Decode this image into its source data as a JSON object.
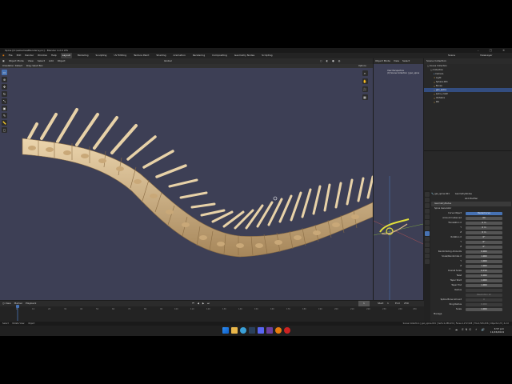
{
  "window": {
    "title": "Spine [D:\\eeGamesBlender\\sync] - Blender 4.2.0 LTS",
    "controls": [
      "–",
      "□",
      "✕"
    ]
  },
  "menubar": {
    "items": [
      "File",
      "Edit",
      "Render",
      "Window",
      "Help"
    ],
    "workspaces": [
      "Layout",
      "Modeling",
      "Sculpting",
      "UV Editing",
      "Texture Paint",
      "Shading",
      "Animation",
      "Rendering",
      "Compositing",
      "Geometry Nodes",
      "Scripting"
    ],
    "active_workspace": "Layout",
    "scene": "Scene",
    "view_layer": "ViewLayer"
  },
  "viewport": {
    "mode": "Object Mode",
    "menus": [
      "View",
      "Select",
      "Add",
      "Object"
    ],
    "orientation": "Global",
    "sub_items": [
      "Orientation:",
      "Default",
      "Drag:",
      "Select Box"
    ],
    "options": "Options"
  },
  "viewport2": {
    "mode": "Object Mode",
    "menus": [
      "View",
      "Select"
    ],
    "info_lines": [
      "User Perspective",
      "(0) Scene Collection | geo_spine"
    ]
  },
  "outliner": {
    "header": "Scene Collection",
    "rows": [
      {
        "label": "Scene Collection",
        "selected": false
      },
      {
        "label": "Collection",
        "selected": false
      },
      {
        "label": "Camera",
        "selected": false
      },
      {
        "label": "Light",
        "selected": false
      },
      {
        "label": "Sphere.001",
        "selected": false
      },
      {
        "label": "Bones",
        "selected": false
      },
      {
        "label": "geo_spine",
        "selected": true
      },
      {
        "label": "spine_mesh",
        "selected": false
      },
      {
        "label": "Vertebra",
        "selected": false
      },
      {
        "label": "Rib",
        "selected": false
      }
    ]
  },
  "properties": {
    "object": "geo_spine.001",
    "modifier_tab": "GeometryNodes",
    "section": "Add Modifier",
    "modifier_name": "GeometryNodes",
    "node_group": "Spine Generator",
    "rows": [
      {
        "label": "Curve Object",
        "value": "BezierCurve"
      },
      {
        "label": "Amount Instanced",
        "value": "60"
      },
      {
        "label": "Translation X",
        "value": "0 m"
      },
      {
        "label": "Y",
        "value": "0 m"
      },
      {
        "label": "Z",
        "value": "0 m"
      },
      {
        "label": "Rotation X",
        "value": "0°"
      },
      {
        "label": "Y",
        "value": "0°"
      },
      {
        "label": "Z",
        "value": "0°"
      },
      {
        "label": "Randomizing Amounts",
        "value": "0.000"
      },
      {
        "label": "Scale/Randomize X",
        "value": "1.000"
      },
      {
        "label": "Y",
        "value": "1.000"
      },
      {
        "label": "Z",
        "value": "1.000"
      },
      {
        "label": "Overall Scale",
        "value": "0.150"
      },
      {
        "label": "Twist",
        "value": "0.000"
      },
      {
        "label": "Taper Start",
        "value": "1.000"
      },
      {
        "label": "Taper End",
        "value": "1.000"
      },
      {
        "label": "Radius",
        "value": ""
      },
      {
        "label": "",
        "value": "Resolution 12"
      },
      {
        "label": "Spline Bone Amount",
        "value": "0"
      },
      {
        "label": "Ring Radius",
        "value": "0.000"
      },
      {
        "label": "Scale",
        "value": "1.000"
      }
    ],
    "footer": "Manage"
  },
  "timeline": {
    "menus": [
      "View",
      "Marker",
      "Playback"
    ],
    "start_label": "Start",
    "start": "1",
    "end_label": "End",
    "end": "250",
    "current": "1",
    "ticks": [
      "0",
      "10",
      "20",
      "30",
      "40",
      "50",
      "60",
      "70",
      "80",
      "90",
      "100",
      "110",
      "120",
      "130",
      "140",
      "150",
      "160",
      "170",
      "180",
      "190",
      "200",
      "210",
      "220",
      "230",
      "240",
      "250"
    ]
  },
  "statusbar": {
    "left": [
      "Select",
      "Rotate View",
      "Object"
    ],
    "right": "Scene Collection | geo_spine.001 | Verts:1,286,431 | Faces:1,272,528 | Tris:2,545,056 | Objects:1/5 | 4.2.0"
  },
  "taskbar": {
    "time": "3:57 pm",
    "date": "11/26/2024",
    "tray": "^ ☁ ENG ⚡ 🔊"
  },
  "colors": {
    "viewport_bg": "#3d3f55",
    "bone": "#d9b98a",
    "accent": "#4772b3",
    "panel": "#282828"
  }
}
